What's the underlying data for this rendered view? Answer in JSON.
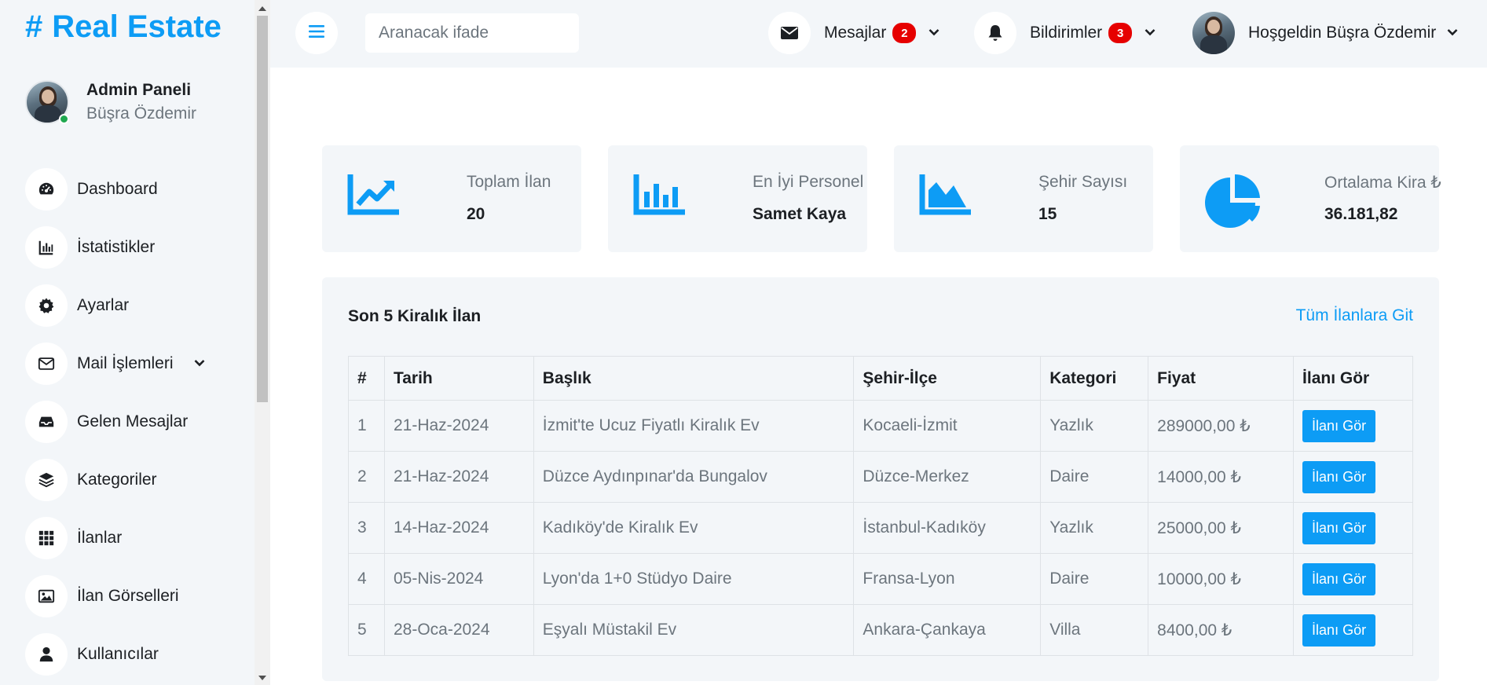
{
  "brand": {
    "hash": "#",
    "name": "Real Estate"
  },
  "profile": {
    "role": "Admin Paneli",
    "name": "Büşra Özdemir"
  },
  "sidebar": {
    "items": [
      {
        "label": "Dashboard",
        "icon": "gauge-icon"
      },
      {
        "label": "İstatistikler",
        "icon": "chart-icon"
      },
      {
        "label": "Ayarlar",
        "icon": "gear-icon"
      },
      {
        "label": "Mail İşlemleri",
        "icon": "envelope-icon"
      },
      {
        "label": "Gelen Mesajlar",
        "icon": "inbox-icon"
      },
      {
        "label": "Kategoriler",
        "icon": "layers-icon"
      },
      {
        "label": "İlanlar",
        "icon": "grid-icon"
      },
      {
        "label": "İlan Görselleri",
        "icon": "image-icon"
      },
      {
        "label": "Kullanıcılar",
        "icon": "user-icon"
      }
    ]
  },
  "topbar": {
    "search_placeholder": "Aranacak ifade",
    "messages_label": "Mesajlar",
    "messages_count": "2",
    "notifications_label": "Bildirimler",
    "notifications_count": "3",
    "welcome": "Hoşgeldin Büşra Özdemir"
  },
  "cards": [
    {
      "label": "Toplam İlan",
      "value": "20",
      "icon": "trend-up-icon"
    },
    {
      "label": "En İyi Personel",
      "value": "Samet Kaya",
      "icon": "bar-chart-icon"
    },
    {
      "label": "Şehir Sayısı",
      "value": "15",
      "icon": "area-chart-icon"
    },
    {
      "label": "Ortalama Kira ₺",
      "value": "36.181,82",
      "icon": "pie-chart-icon"
    }
  ],
  "table": {
    "title": "Son 5 Kiralık İlan",
    "link": "Tüm İlanlara Git",
    "headers": [
      "#",
      "Tarih",
      "Başlık",
      "Şehir-İlçe",
      "Kategori",
      "Fiyat",
      "İlanı Gör"
    ],
    "rows": [
      [
        "1",
        "21-Haz-2024",
        "İzmit'te Ucuz Fiyatlı Kiralık Ev",
        "Kocaeli-İzmit",
        "Yazlık",
        "289000,00 ₺",
        "İlanı Gör"
      ],
      [
        "2",
        "21-Haz-2024",
        "Düzce Aydınpınar'da Bungalov",
        "Düzce-Merkez",
        "Daire",
        "14000,00 ₺",
        "İlanı Gör"
      ],
      [
        "3",
        "14-Haz-2024",
        "Kadıköy'de Kiralık Ev",
        "İstanbul-Kadıköy",
        "Yazlık",
        "25000,00 ₺",
        "İlanı Gör"
      ],
      [
        "4",
        "05-Nis-2024",
        "Lyon'da 1+0 Stüdyo Daire",
        "Fransa-Lyon",
        "Daire",
        "10000,00 ₺",
        "İlanı Gör"
      ],
      [
        "5",
        "28-Oca-2024",
        "Eşyalı Müstakil Ev",
        "Ankara-Çankaya",
        "Villa",
        "8400,00 ₺",
        "İlanı Gör"
      ]
    ]
  },
  "colors": {
    "accent": "#0d9cf5",
    "badge": "#e60000",
    "panel_bg": "#f3f6f9"
  }
}
